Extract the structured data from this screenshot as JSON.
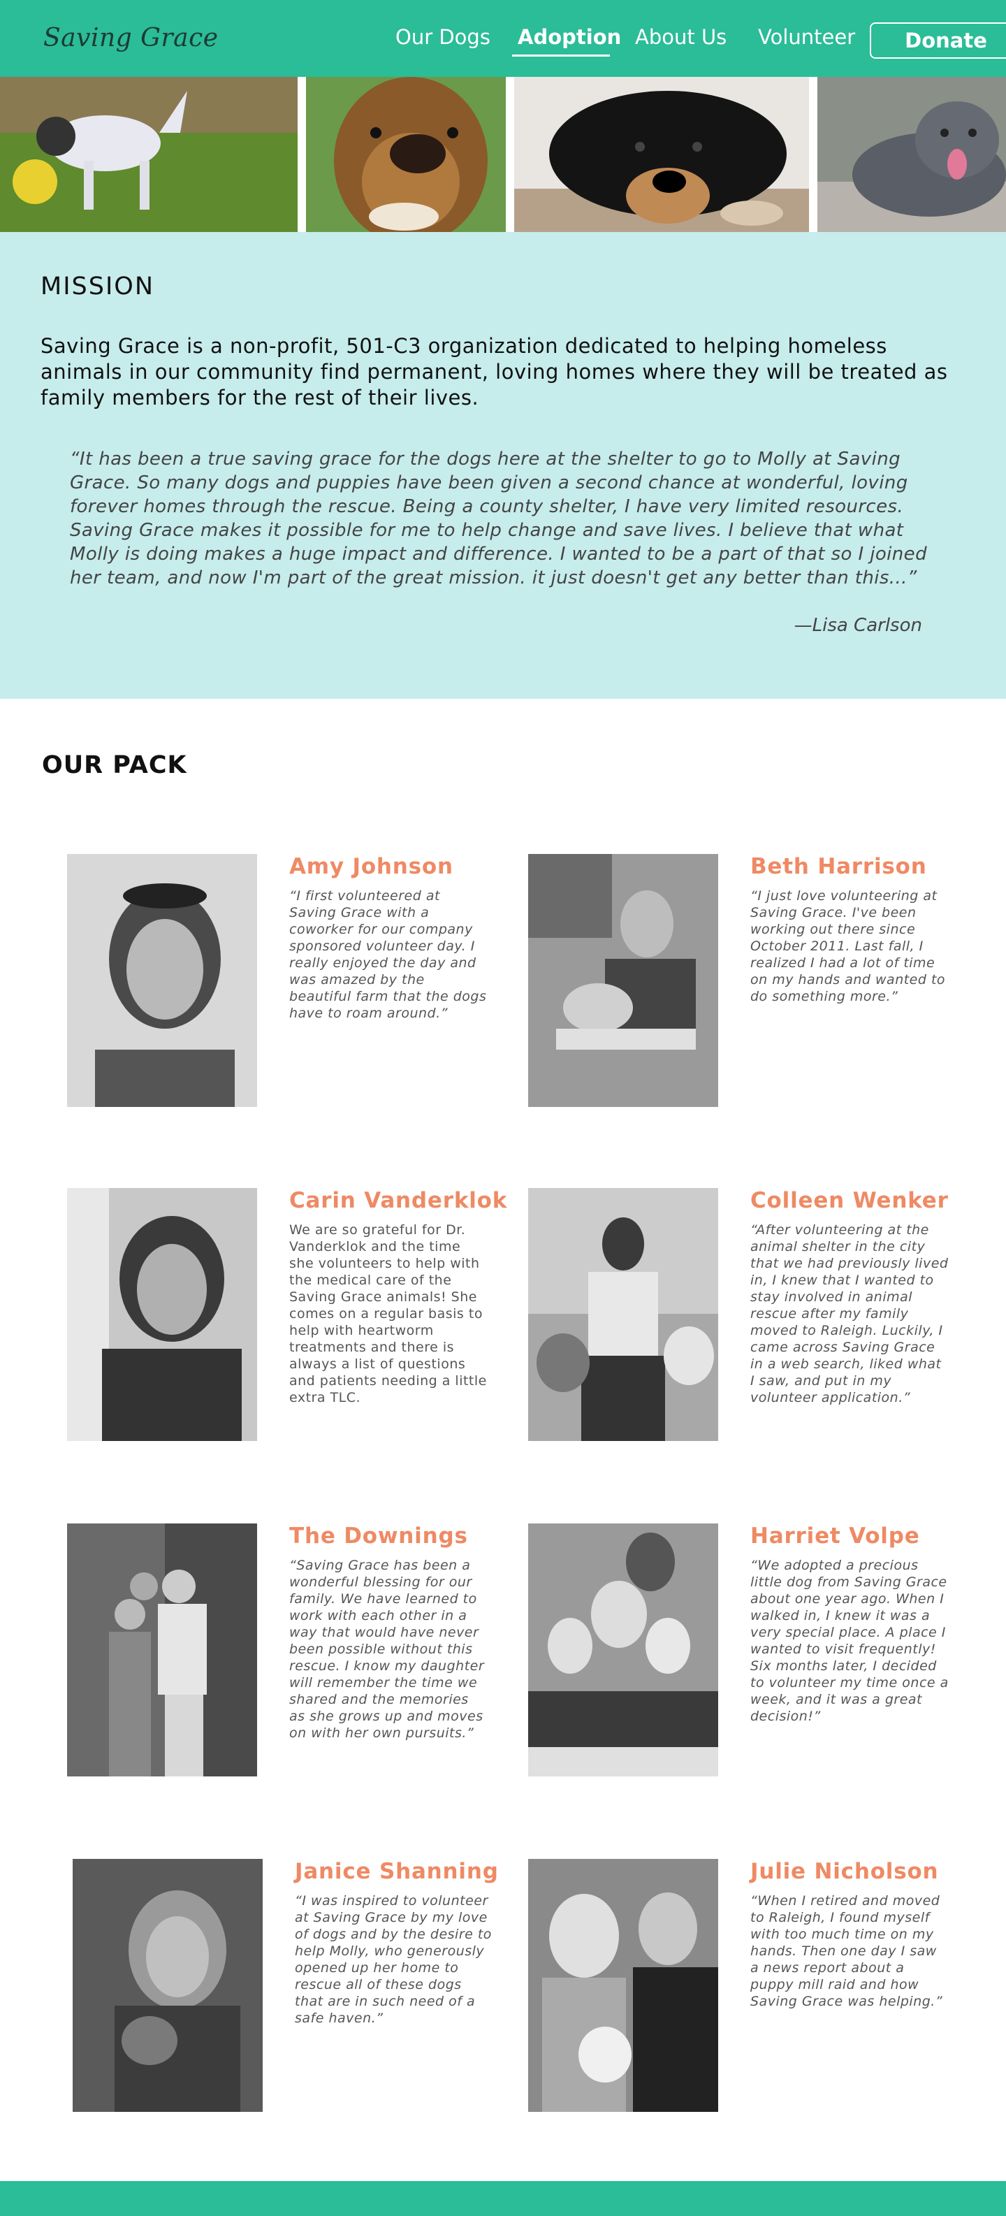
{
  "nav": {
    "logo": "Saving Grace",
    "links": [
      "Our Dogs",
      "Adoption",
      "About Us",
      "Volunteer"
    ],
    "active": "Adoption",
    "donate": "Donate"
  },
  "colors": {
    "brand": "#2bbc98",
    "mission_bg": "#c7ecec",
    "name_accent": "#ee8a64"
  },
  "mission": {
    "title": "MISSION",
    "lead": "Saving Grace is a non-profit, 501-C3 organization dedicated to helping homeless animals in our community find permanent, loving homes where they will be treated as family members for the rest of their lives.",
    "quote": "“It has been a true saving grace for the dogs here at the shelter to go to Molly at Saving Grace. So many dogs and puppies have been given a second chance at wonderful, loving forever homes through the rescue. Being a county shelter, I have very limited resources. Saving Grace makes it possible for me to help change and save lives. I believe that what Molly is doing makes a huge impact and difference. I wanted to be a part of that so I joined her team, and now I'm part of the great mission. it just doesn't get any better than this...”",
    "signature": "—Lisa Carlson"
  },
  "pack": {
    "title": "OUR PACK",
    "members": [
      {
        "name": "Amy Johnson",
        "text": "“I first volunteered at Saving Grace with a coworker for our company sponsored volunteer day. I really enjoyed the day and was amazed by the beautiful farm that the dogs have to roam around.”"
      },
      {
        "name": "Beth Harrison",
        "text": "“I just love volunteering at Saving Grace. I've been working out there since October 2011. Last fall, I realized I had a lot of time on my hands and wanted to do something more.”"
      },
      {
        "name": "Carin Vanderklok",
        "text": "We are so grateful for Dr. Vanderklok and the time she volunteers to help with the medical care of the Saving Grace animals! She comes on a regular basis to help with heartworm treatments and there is always a list of questions and patients needing a little extra TLC."
      },
      {
        "name": "Colleen Wenker",
        "text": "“After volunteering at the animal shelter in the city that we had previously lived in, I knew that I wanted to stay involved in animal rescue after my family moved to Raleigh. Luckily, I came across Saving Grace in a web search, liked what I saw, and put in my volunteer application.”"
      },
      {
        "name": "The Downings",
        "text": "“Saving Grace has been a wonderful blessing for our family. We have learned to work with each other in a way that would have never been possible without this rescue. I know my daughter will remember the time we shared and the memories as she grows up and moves on with her own pursuits.”"
      },
      {
        "name": "Harriet Volpe",
        "text": "“We adopted a precious little dog from Saving Grace about one year ago. When I walked in, I knew it was a very special place. A place I wanted to visit frequently! Six months later, I decided to volunteer my time once a week, and it was a great decision!”"
      },
      {
        "name": "Janice Shanning",
        "text": "“I was inspired to volunteer at Saving Grace by my love of dogs and by the desire to help Molly, who generously opened up her home to rescue all of these dogs that are in such need of a safe haven.”"
      },
      {
        "name": "Julie Nicholson",
        "text": "“When I retired and moved to Raleigh, I found myself with too much time on my hands. Then one day I saw a news report about a puppy mill raid and how Saving Grace was helping.”"
      }
    ]
  }
}
